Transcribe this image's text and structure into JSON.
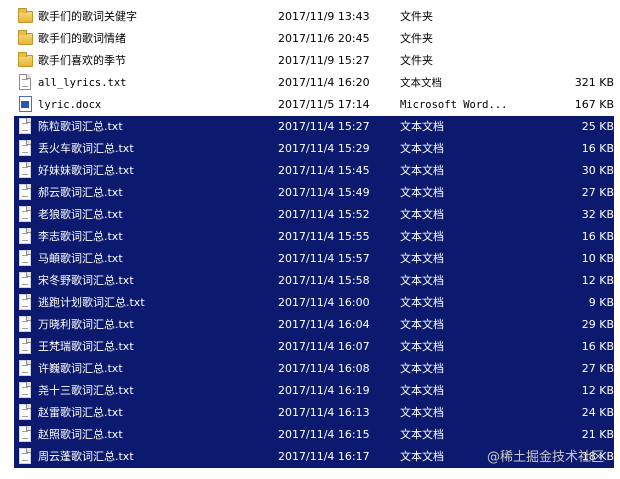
{
  "files": [
    {
      "icon": "folder-icon",
      "name": "歌手们的歌词关健字",
      "date": "2017/11/9 13:43",
      "type": "文件夹",
      "size": "",
      "mono": false,
      "selected": false
    },
    {
      "icon": "folder-icon",
      "name": "歌手们的歌词情绪",
      "date": "2017/11/6 20:45",
      "type": "文件夹",
      "size": "",
      "mono": false,
      "selected": false
    },
    {
      "icon": "folder-icon",
      "name": "歌手们喜欢的季节",
      "date": "2017/11/9 15:27",
      "type": "文件夹",
      "size": "",
      "mono": false,
      "selected": false
    },
    {
      "icon": "text-file-icon",
      "name": "all_lyrics.txt",
      "date": "2017/11/4 16:20",
      "type": "文本文档",
      "size": "321 KB",
      "mono": true,
      "selected": false
    },
    {
      "icon": "word-file-icon",
      "name": "lyric.docx",
      "date": "2017/11/5 17:14",
      "type": "Microsoft Word...",
      "size": "167 KB",
      "mono": true,
      "selected": false
    },
    {
      "icon": "text-file-icon",
      "name": "陈粒歌词汇总.txt",
      "date": "2017/11/4 15:27",
      "type": "文本文档",
      "size": "25 KB",
      "mono": false,
      "selected": true
    },
    {
      "icon": "text-file-icon",
      "name": "丢火车歌词汇总.txt",
      "date": "2017/11/4 15:29",
      "type": "文本文档",
      "size": "16 KB",
      "mono": false,
      "selected": true
    },
    {
      "icon": "text-file-icon",
      "name": "好妹妹歌词汇总.txt",
      "date": "2017/11/4 15:45",
      "type": "文本文档",
      "size": "30 KB",
      "mono": false,
      "selected": true
    },
    {
      "icon": "text-file-icon",
      "name": "郝云歌词汇总.txt",
      "date": "2017/11/4 15:49",
      "type": "文本文档",
      "size": "27 KB",
      "mono": false,
      "selected": true
    },
    {
      "icon": "text-file-icon",
      "name": "老狼歌词汇总.txt",
      "date": "2017/11/4 15:52",
      "type": "文本文档",
      "size": "32 KB",
      "mono": false,
      "selected": true
    },
    {
      "icon": "text-file-icon",
      "name": "李志歌词汇总.txt",
      "date": "2017/11/4 15:55",
      "type": "文本文档",
      "size": "16 KB",
      "mono": false,
      "selected": true
    },
    {
      "icon": "text-file-icon",
      "name": "马頔歌词汇总.txt",
      "date": "2017/11/4 15:57",
      "type": "文本文档",
      "size": "10 KB",
      "mono": false,
      "selected": true
    },
    {
      "icon": "text-file-icon",
      "name": "宋冬野歌词汇总.txt",
      "date": "2017/11/4 15:58",
      "type": "文本文档",
      "size": "12 KB",
      "mono": false,
      "selected": true
    },
    {
      "icon": "text-file-icon",
      "name": "逃跑计划歌词汇总.txt",
      "date": "2017/11/4 16:00",
      "type": "文本文档",
      "size": "9 KB",
      "mono": false,
      "selected": true
    },
    {
      "icon": "text-file-icon",
      "name": "万晓利歌词汇总.txt",
      "date": "2017/11/4 16:04",
      "type": "文本文档",
      "size": "29 KB",
      "mono": false,
      "selected": true
    },
    {
      "icon": "text-file-icon",
      "name": "王梵瑞歌词汇总.txt",
      "date": "2017/11/4 16:07",
      "type": "文本文档",
      "size": "16 KB",
      "mono": false,
      "selected": true
    },
    {
      "icon": "text-file-icon",
      "name": "许巍歌词汇总.txt",
      "date": "2017/11/4 16:08",
      "type": "文本文档",
      "size": "27 KB",
      "mono": false,
      "selected": true
    },
    {
      "icon": "text-file-icon",
      "name": "尧十三歌词汇总.txt",
      "date": "2017/11/4 16:19",
      "type": "文本文档",
      "size": "12 KB",
      "mono": false,
      "selected": true
    },
    {
      "icon": "text-file-icon",
      "name": "赵雷歌词汇总.txt",
      "date": "2017/11/4 16:13",
      "type": "文本文档",
      "size": "24 KB",
      "mono": false,
      "selected": true
    },
    {
      "icon": "text-file-icon",
      "name": "赵照歌词汇总.txt",
      "date": "2017/11/4 16:15",
      "type": "文本文档",
      "size": "21 KB",
      "mono": false,
      "selected": true
    },
    {
      "icon": "text-file-icon",
      "name": "周云蓬歌词汇总.txt",
      "date": "2017/11/4 16:17",
      "type": "文本文档",
      "size": "18 KB",
      "mono": false,
      "selected": true
    }
  ],
  "watermark": "@稀土掘金技术社区",
  "colors": {
    "selection": "#0b1a6e",
    "selection_text": "#ffffff",
    "background": "#ffffff"
  }
}
